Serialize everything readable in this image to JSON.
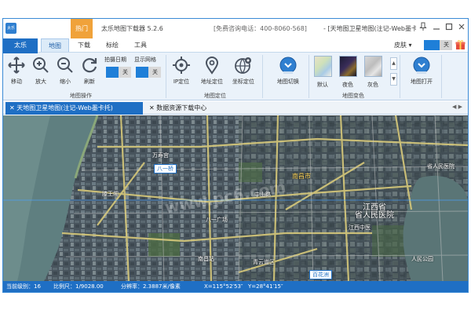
{
  "titlebar": {
    "logo": "太乐",
    "hot_tab": "热门",
    "app_title": "太乐地图下载器 5.2.6",
    "hotline": "[免费咨询电话：400-8060-568]",
    "doc_title": "- [天地图卫星地图(注记-Web墨卡托)]",
    "window_buttons": [
      "pin-icon",
      "minimize-icon",
      "maximize-icon",
      "close-icon"
    ]
  },
  "tabs": {
    "brand": "太乐",
    "items": [
      "地图",
      "下载",
      "标绘",
      "工具"
    ],
    "active": "地图"
  },
  "skin": {
    "label": "皮肤 ▾",
    "toggle_text": "关"
  },
  "ribbon": {
    "map_ops": {
      "buttons": [
        "移动",
        "放大",
        "缩小",
        "刷新"
      ],
      "date_label": "拍摄日期",
      "grid_label": "显示网格",
      "date_toggle": "关",
      "grid_toggle": "关",
      "group_label": "地图操作"
    },
    "map_locate": {
      "buttons": [
        "IP定位",
        "地址定位",
        "坐标定位"
      ],
      "group_label": "地图定位"
    },
    "map_switch": {
      "label": "地图切换"
    },
    "map_color": {
      "styles": [
        "默认",
        "夜色",
        "灰色"
      ],
      "group_label": "地图变色"
    },
    "map_open": {
      "label": "地图打开"
    }
  },
  "doc_tabs": [
    {
      "label": "天地图卫星地图(注记-Web墨卡托)",
      "active": true
    },
    {
      "label": "数据资源下载中心",
      "active": false
    }
  ],
  "map": {
    "labels": [
      "八一桥",
      "滕王阁",
      "江西省",
      "南昌市",
      "青云谱区",
      "百花洲",
      "八一广场",
      "江西中医",
      "人民公园",
      "省人民医院",
      "省人民医院",
      "南昌站",
      "万寿宫",
      "中山路"
    ],
    "watermark": "www.pc6.com"
  },
  "status": {
    "level": "当前级别：16",
    "scale": "比例尺：1/9028.00",
    "resolution": "分辨率：2.3887米/像素",
    "x": "X=115°52′53″",
    "y": "Y=28°41′15″"
  },
  "colors": {
    "brand_blue": "#1f6fc4",
    "hot_orange": "#f0a23a",
    "ribbon_bg": "#eaf2fa",
    "toggle_on": "#1f7fd8",
    "river": "#5f7f80"
  }
}
